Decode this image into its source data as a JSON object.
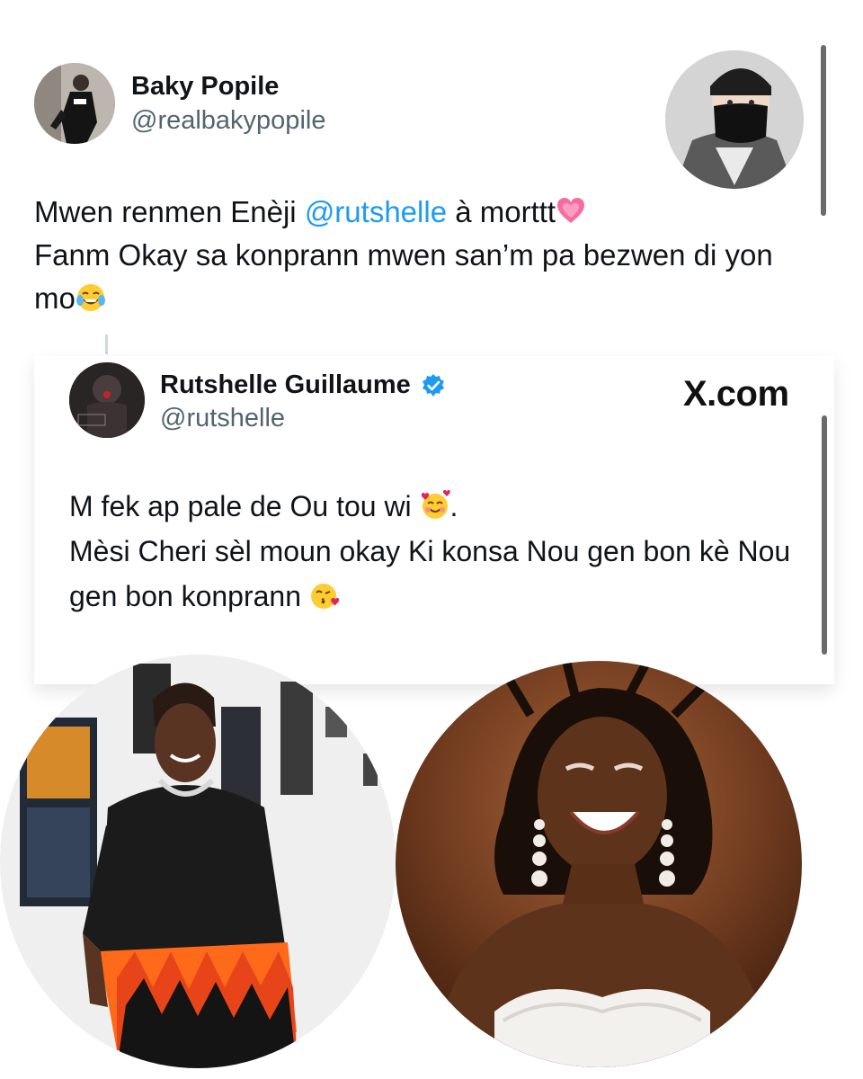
{
  "top_tweet": {
    "name": "Baky Popile",
    "handle": "@realbakypopile",
    "text_line1_a": "Mwen renmen Enèji ",
    "mention": "@rutshelle",
    "text_line1_b": " à morttt",
    "text_line2": "Fanm Okay sa konprann mwen san’m pa bezwen di yon",
    "text_line3": "mo"
  },
  "quoted_tweet": {
    "name": "Rutshelle Guillaume",
    "handle": "@rutshelle",
    "source_label": "X.com",
    "text_line1": "M fek ap pale de Ou tou wi",
    "text_line1_end": ".",
    "text_line2": "Mèsi Cheri sèl moun okay Ki konsa Nou gen bon kè Nou",
    "text_line3": "gen bon konprann"
  },
  "icons": {
    "verified": "verified-badge-icon",
    "emoji_heart": "growing-heart-emoji",
    "emoji_laugh": "tears-of-joy-emoji",
    "emoji_hearts_face": "smiling-face-with-hearts-emoji",
    "emoji_kiss": "face-blowing-kiss-emoji"
  },
  "colors": {
    "mention": "#1d9bf0",
    "handle": "#536471",
    "verified": "#1d9bf0"
  }
}
